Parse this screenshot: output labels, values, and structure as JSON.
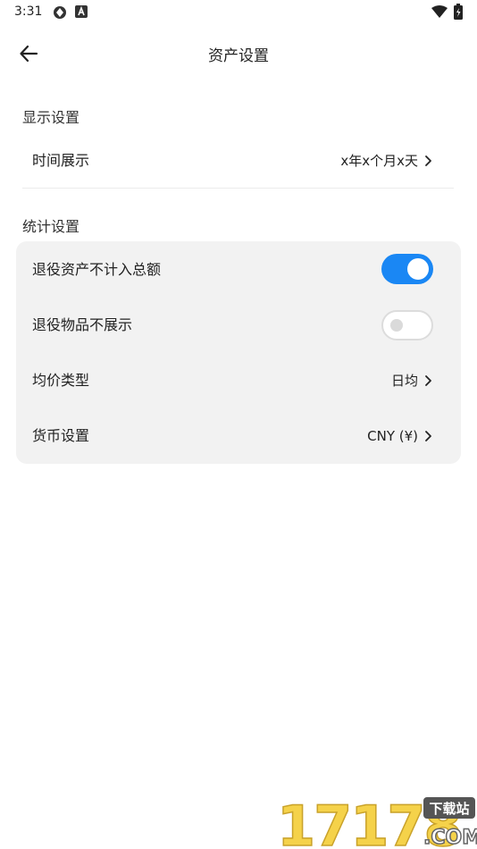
{
  "status_bar": {
    "time": "3:31",
    "icons": [
      "settings-cog-icon",
      "text-box-icon",
      "wifi-icon",
      "battery-icon"
    ]
  },
  "app_bar": {
    "title": "资产设置",
    "back_icon": "arrow-left-icon"
  },
  "display_section": {
    "title": "显示设置",
    "items": [
      {
        "label": "时间展示",
        "value": "x年x个月x天",
        "chevron": "chevron-right-icon"
      }
    ]
  },
  "stats_section": {
    "title": "统计设置",
    "items": [
      {
        "label": "退役资产不计入总额",
        "type": "toggle",
        "checked": true
      },
      {
        "label": "退役物品不展示",
        "type": "toggle",
        "checked": false
      },
      {
        "label": "均价类型",
        "value": "日均",
        "chevron": "chevron-right-icon"
      },
      {
        "label": "货币设置",
        "value": "CNY (¥)",
        "chevron": "chevron-right-icon"
      }
    ]
  },
  "watermark": {
    "text": "17178",
    "badge": "下载站",
    "suffix": ".COM"
  },
  "colors": {
    "accent": "#1a87f4",
    "card_background": "#f2f2f2",
    "watermark_yellow": "#f5d24a"
  }
}
